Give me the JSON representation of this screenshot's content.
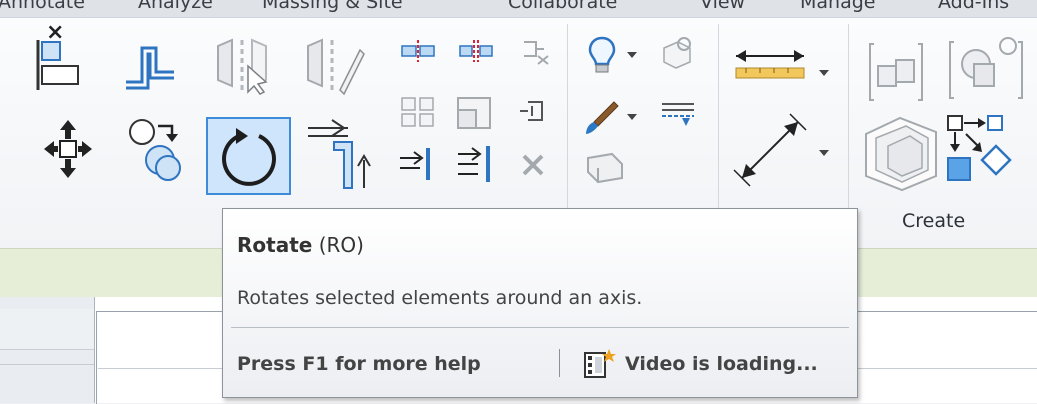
{
  "menu": {
    "tabs": [
      "Annotate",
      "Analyze",
      "Massing & Site",
      "Collaborate",
      "View",
      "Manage",
      "Add-Ins"
    ]
  },
  "ribbon": {
    "panels": [
      {
        "label": ""
      },
      {
        "label": ""
      },
      {
        "label": "Create"
      }
    ]
  },
  "tooltip": {
    "command": "Rotate",
    "shortcut": "(RO)",
    "description": "Rotates selected elements around an axis.",
    "help": "Press F1 for more help",
    "video_status": "Video is loading..."
  },
  "properties_close": "×",
  "colors": {
    "accent": "#3d8bd9",
    "icon_blue": "#2e74c0",
    "ruler_yellow": "#f2c75b"
  }
}
